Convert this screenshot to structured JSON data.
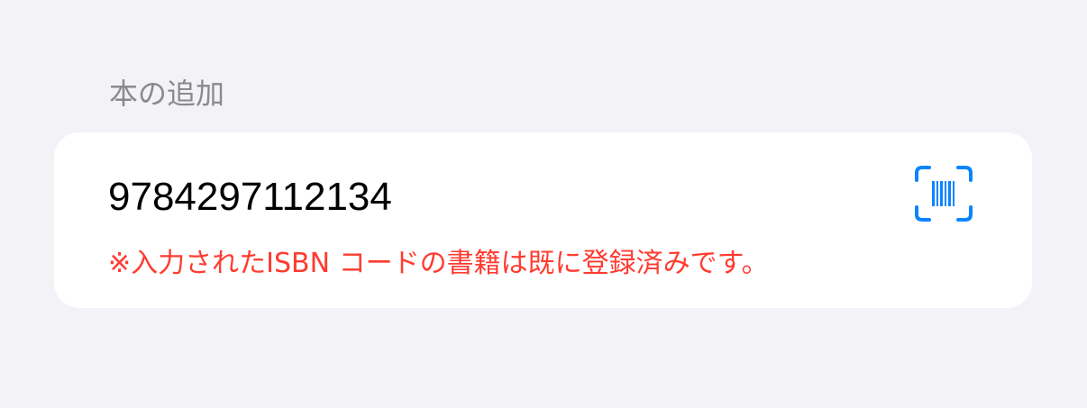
{
  "section": {
    "title": "本の追加"
  },
  "isbn_input": {
    "value": "9784297112134"
  },
  "scan_button": {
    "icon": "barcode-scan-icon",
    "color": "#0a84ff"
  },
  "error": {
    "message": "※入力されたISBN コードの書籍は既に登録済みです。",
    "color": "#ff3b30"
  }
}
